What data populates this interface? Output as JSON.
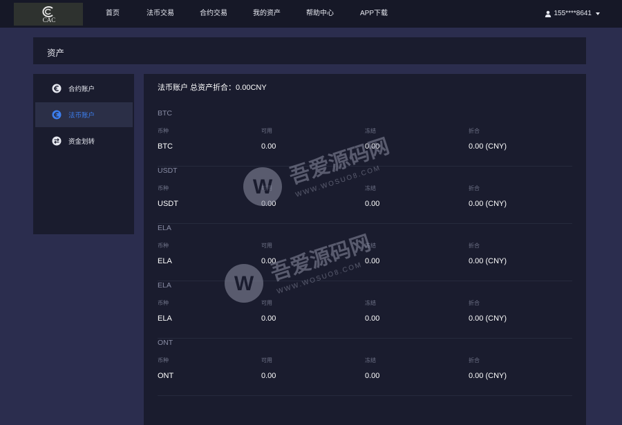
{
  "header": {
    "logo_text": "CAC",
    "nav": [
      "首页",
      "法币交易",
      "合约交易",
      "我的资产",
      "帮助中心",
      "APP下载"
    ],
    "user": "155****8641"
  },
  "page_title": "资产",
  "sidebar": {
    "items": [
      {
        "label": "合约账户",
        "icon": "euro-coin-icon",
        "active": false
      },
      {
        "label": "法币账户",
        "icon": "euro-coin-icon",
        "active": true
      },
      {
        "label": "资金划转",
        "icon": "transfer-icon",
        "active": false
      }
    ]
  },
  "main": {
    "title": "法币账户 总资产折合：0.00CNY",
    "columns": [
      "币种",
      "可用",
      "冻结",
      "折合"
    ],
    "assets": [
      {
        "name": "BTC",
        "coin": "BTC",
        "available": "0.00",
        "frozen": "0.00",
        "value": "0.00 (CNY)"
      },
      {
        "name": "USDT",
        "coin": "USDT",
        "available": "0.00",
        "frozen": "0.00",
        "value": "0.00 (CNY)"
      },
      {
        "name": "ELA",
        "coin": "ELA",
        "available": "0.00",
        "frozen": "0.00",
        "value": "0.00 (CNY)"
      },
      {
        "name": "ELA",
        "coin": "ELA",
        "available": "0.00",
        "frozen": "0.00",
        "value": "0.00 (CNY)"
      },
      {
        "name": "ONT",
        "coin": "ONT",
        "available": "0.00",
        "frozen": "0.00",
        "value": "0.00 (CNY)"
      }
    ]
  },
  "watermark": {
    "title": "吾爱源码网",
    "url": "WWW.WOSUO8.COM"
  },
  "colors": {
    "accent": "#3c7ff0",
    "topbar": "#161827",
    "panel": "#1a1c2e",
    "background": "#2b2d4e"
  }
}
